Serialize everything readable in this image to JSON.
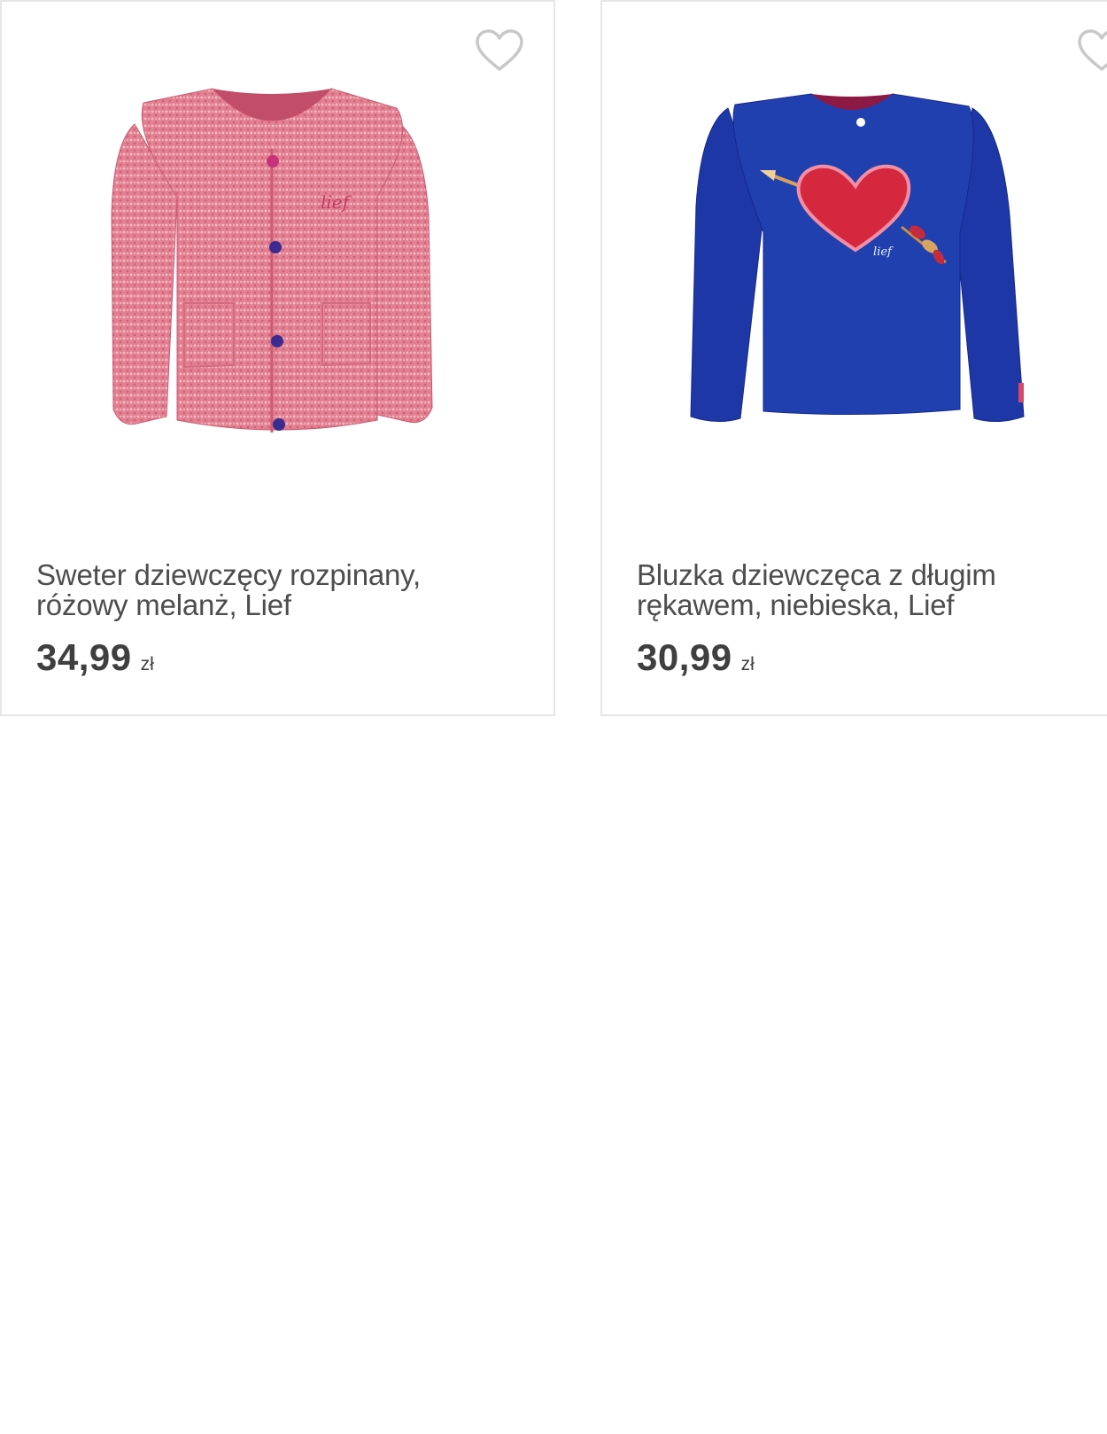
{
  "products": [
    {
      "title": "Sweter dziewczęcy rozpinany, różowy melanż, Lief",
      "price": "34,99",
      "currency": "zł",
      "favorite_icon": "heart-outline-icon",
      "logo_text": "lief"
    },
    {
      "title": "Bluzka dziewczęca z długim rękawem, niebieska, Lief",
      "price": "30,99",
      "currency": "zł",
      "favorite_icon": "heart-outline-icon",
      "logo_text": "lief"
    }
  ],
  "colors": {
    "card_border": "#e6e6e6",
    "text": "#4d4d4d",
    "price": "#3f3f3f",
    "icon": "#c8c8c8",
    "sweater": "#e07a8c",
    "blouse": "#1d37a6",
    "heart_applique": "#d5283e"
  }
}
